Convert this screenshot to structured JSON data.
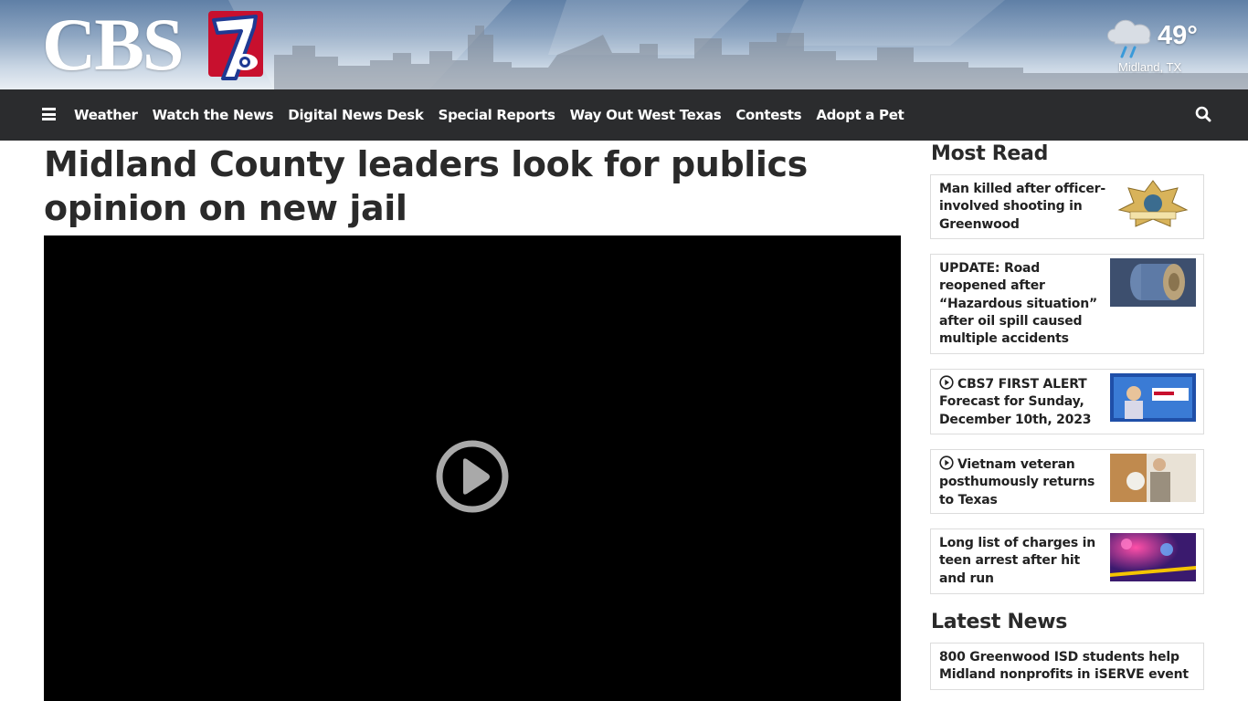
{
  "header": {
    "logo_text": "CBS",
    "logo_number": "7",
    "weather": {
      "temperature": "49°",
      "location": "Midland, TX",
      "icon": "rain-cloud-icon"
    }
  },
  "nav": {
    "items": [
      {
        "label": "Weather"
      },
      {
        "label": "Watch the News"
      },
      {
        "label": "Digital News Desk"
      },
      {
        "label": "Special Reports"
      },
      {
        "label": "Way Out West Texas"
      },
      {
        "label": "Contests"
      },
      {
        "label": "Adopt a Pet"
      }
    ],
    "menu_icon": "hamburger-menu-icon",
    "search_icon": "search-icon"
  },
  "article": {
    "headline": "Midland County leaders look for publics opinion on new jail",
    "video": {
      "state": "paused",
      "icon": "play-circle-icon"
    }
  },
  "sidebar": {
    "most_read_title": "Most Read",
    "most_read": [
      {
        "title": "Man killed after officer-involved shooting in Greenwood",
        "has_video": false
      },
      {
        "title": "UPDATE: Road reopened after “Hazardous situation” after oil spill caused multiple accidents",
        "has_video": false
      },
      {
        "title": "CBS7 FIRST ALERT Forecast for Sunday, December 10th, 2023",
        "has_video": true
      },
      {
        "title": "Vietnam veteran posthumously returns to Texas",
        "has_video": true
      },
      {
        "title": "Long list of charges in teen arrest after hit and run",
        "has_video": false
      }
    ],
    "latest_news_title": "Latest News",
    "latest_news": [
      {
        "title": "800 Greenwood ISD students help Midland nonprofits in iSERVE event"
      }
    ]
  },
  "colors": {
    "nav_background": "#2b2c2e",
    "logo_red": "#c8102e",
    "logo_blue": "#1f3a93",
    "text_dark": "#2a2a2a"
  }
}
